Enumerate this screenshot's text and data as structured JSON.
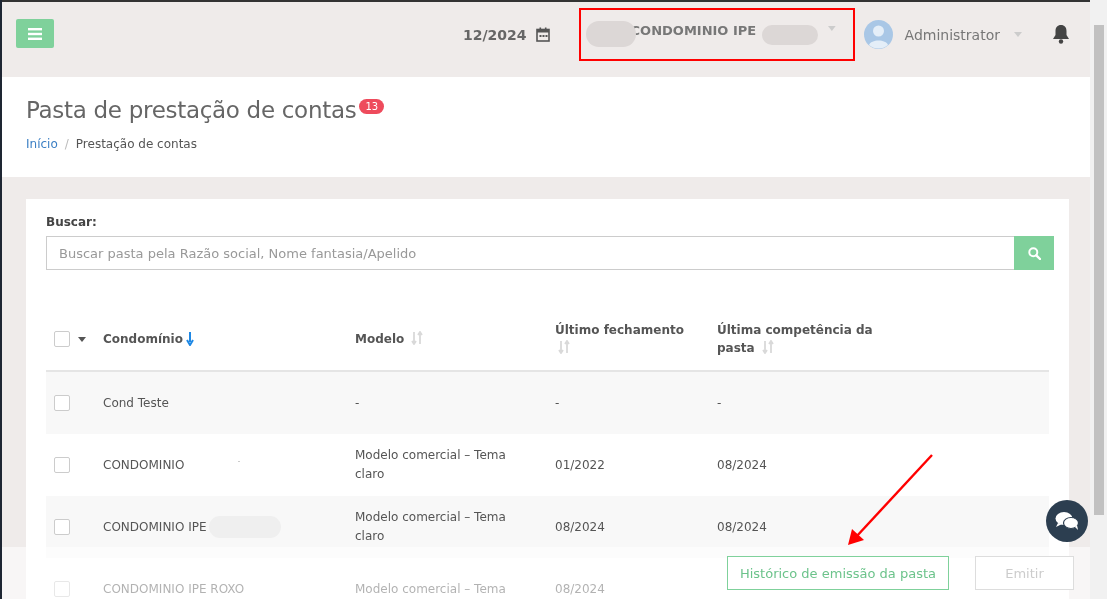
{
  "topbar": {
    "period": "12/2024",
    "condominium": "CONDOMINIO IPE",
    "user": "Administrator"
  },
  "page": {
    "title": "Pasta de prestação de contas",
    "badge": "13",
    "breadcrumb_separator": "/",
    "breadcrumb": [
      {
        "label": "Início",
        "kind": "link"
      },
      {
        "label": "Prestação de contas",
        "kind": "current"
      }
    ]
  },
  "search": {
    "label": "Buscar:",
    "placeholder": "Buscar pasta pela Razão social, Nome fantasia/Apelido"
  },
  "table": {
    "select_all_checked": false,
    "columns": [
      {
        "label": "Condomínio",
        "sorted": true
      },
      {
        "label": "Modelo",
        "sorted": false
      },
      {
        "label": "Último fechamento",
        "sorted": false
      },
      {
        "label": "Última competência da pasta",
        "sorted": false
      }
    ],
    "rows": [
      {
        "checked": false,
        "cells": [
          "Cond Teste",
          "-",
          "-",
          "-"
        ]
      },
      {
        "checked": false,
        "cells": [
          "CONDOMINIO",
          "Modelo comercial – Tema claro",
          "01/2022",
          "08/2024"
        ]
      },
      {
        "checked": false,
        "cells": [
          "CONDOMINIO IPE",
          "Modelo comercial – Tema claro",
          "08/2024",
          "08/2024"
        ]
      },
      {
        "checked": false,
        "cells": [
          "CONDOMINIO IPE ROXO",
          "Modelo comercial – Tema",
          "08/2024"
        ]
      }
    ]
  },
  "footer": {
    "buttons": [
      {
        "label": "Histórico de emissão da pasta",
        "disabled": false
      },
      {
        "label": "Emitir",
        "disabled": true
      }
    ]
  }
}
